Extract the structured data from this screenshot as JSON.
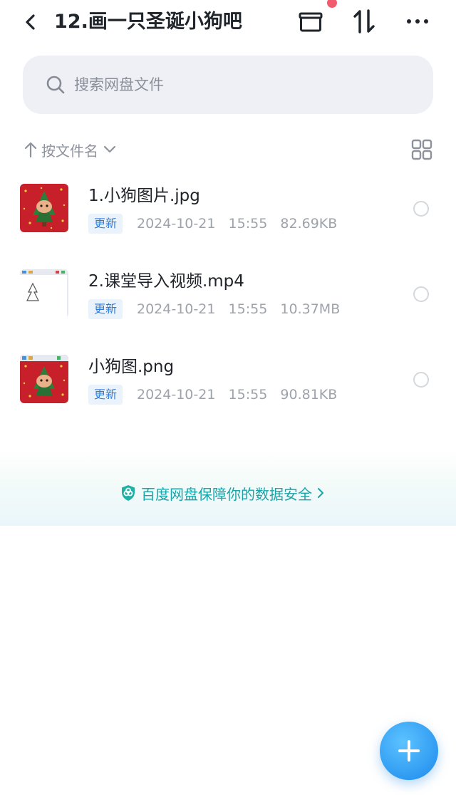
{
  "header": {
    "title": "12.画一只圣诞小狗吧",
    "icons": [
      "back-icon",
      "archive-box-icon",
      "sort-swap-icon",
      "more-icon"
    ],
    "notification_dot_color": "#f25b6e"
  },
  "search": {
    "placeholder": "搜索网盘文件"
  },
  "sort": {
    "label": "按文件名"
  },
  "files": [
    {
      "name": "1.小狗图片.jpg",
      "badge": "更新",
      "meta": "2024-10-21   15:55   82.69KB"
    },
    {
      "name": "2.课堂导入视频.mp4",
      "badge": "更新",
      "meta": "2024-10-21   15:55   10.37MB"
    },
    {
      "name": "小狗图.png",
      "badge": "更新",
      "meta": "2024-10-21   15:55   90.81KB"
    }
  ],
  "banner": {
    "text": "百度网盘保障你的数据安全"
  },
  "colors": {
    "accent": "#2f9af2",
    "badge_text": "#2f7bd9",
    "banner_text": "#1aa4a8"
  }
}
